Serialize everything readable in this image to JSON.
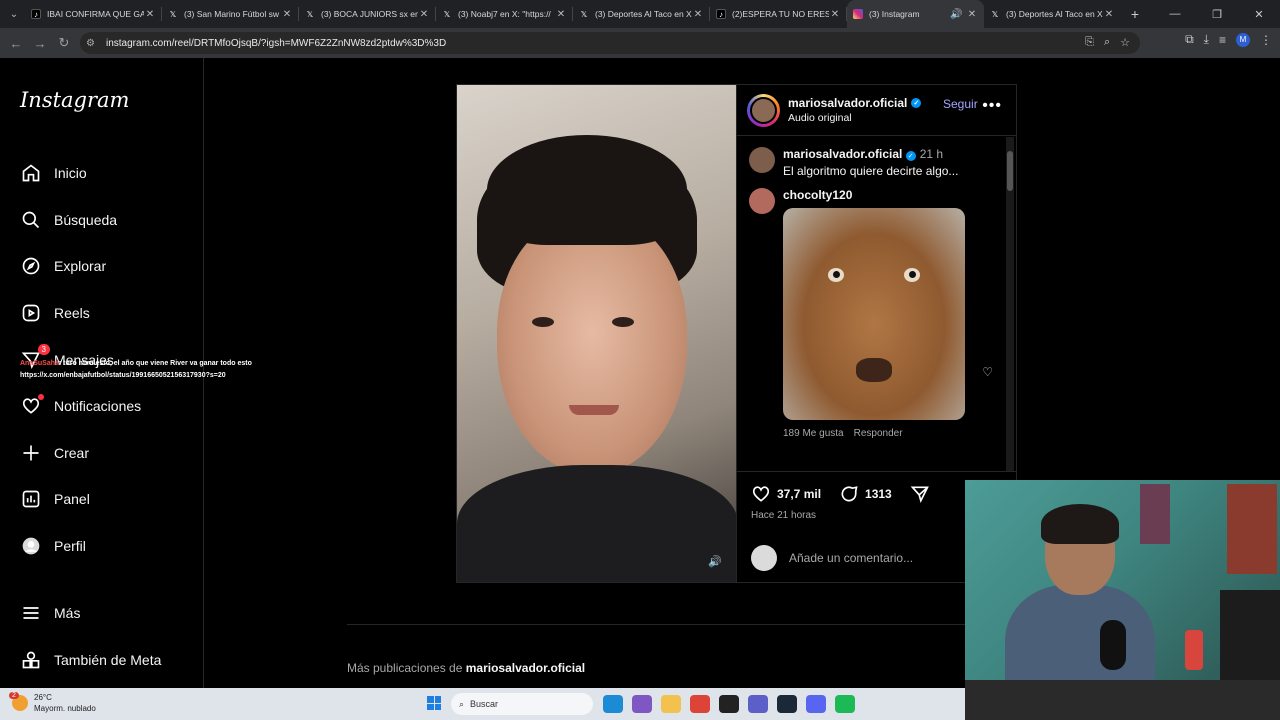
{
  "browser": {
    "tabs": [
      {
        "title": "IBAI CONFIRMA QUE GA",
        "icon": "tiktok-icon",
        "color": "#000000"
      },
      {
        "title": "(3) San Marino Fútbol sw",
        "icon": "x-icon",
        "color": "#000000"
      },
      {
        "title": "(3) BOCA JUNIORS sx en",
        "icon": "x-icon",
        "color": "#000000"
      },
      {
        "title": "(3) Noabj7 en X: \"https://",
        "icon": "x-icon",
        "color": "#000000"
      },
      {
        "title": "(3) Deportes Al Taco en X",
        "icon": "x-icon",
        "color": "#000000"
      },
      {
        "title": "(2)ESPERA TU NO ERES M",
        "icon": "tiktok-icon",
        "color": "#000000"
      },
      {
        "title": "(3) Instagram",
        "icon": "instagram-icon",
        "color": "#d62976",
        "active": true
      },
      {
        "title": "(3) Deportes Al Taco en X",
        "icon": "x-icon",
        "color": "#000000"
      }
    ],
    "url": "instagram.com/reel/DRTMfoOjsqB/?igsh=MWF6Z2ZnNW8zd2ptdw%3D%3D",
    "profile_initial": "M"
  },
  "sidebar": {
    "logo": "Instagram",
    "items": [
      {
        "label": "Inicio",
        "icon": "home-icon"
      },
      {
        "label": "Búsqueda",
        "icon": "search-icon"
      },
      {
        "label": "Explorar",
        "icon": "compass-icon"
      },
      {
        "label": "Reels",
        "icon": "reels-icon"
      },
      {
        "label": "Mensajes",
        "icon": "messages-icon",
        "badge": "3"
      },
      {
        "label": "Notificaciones",
        "icon": "heart-icon",
        "dot": true
      },
      {
        "label": "Crear",
        "icon": "plus-icon"
      },
      {
        "label": "Panel",
        "icon": "dashboard-icon"
      },
      {
        "label": "Perfil",
        "icon": "profile-icon"
      }
    ],
    "more_items": [
      {
        "label": "Más",
        "icon": "menu-icon"
      },
      {
        "label": "También de Meta",
        "icon": "meta-apps-icon"
      }
    ]
  },
  "chat_overlay": {
    "user": "AnaSuSaha",
    "message": ": toro mira esto, el año que viene River va ganar todo esto",
    "link": "https://x.com/enbajafutbol/status/1991665052156317930?s=20"
  },
  "reel": {
    "author": "mariosalvador.oficial",
    "audio": "Audio original",
    "follow_label": "Seguir",
    "caption_time": "21 h",
    "caption": "El algoritmo quiere decirte algo...",
    "comment": {
      "user": "chocolty120",
      "likes": "189 Me gusta",
      "reply": "Responder"
    },
    "likes_count": "37,7 mil",
    "comments_count": "1313",
    "posted": "Hace 21 horas",
    "add_comment_placeholder": "Añade un comentario..."
  },
  "more_posts": {
    "prefix": "Más publicaciones de ",
    "author": "mariosalvador.oficial"
  },
  "taskbar": {
    "temperature": "26°C",
    "weather": "Mayorm. nublado",
    "weather_badge": "2",
    "search_placeholder": "Buscar"
  },
  "colors": {
    "accent_follow": "#a3a6ff",
    "verified": "#0095f6",
    "notification": "#ff3040"
  }
}
